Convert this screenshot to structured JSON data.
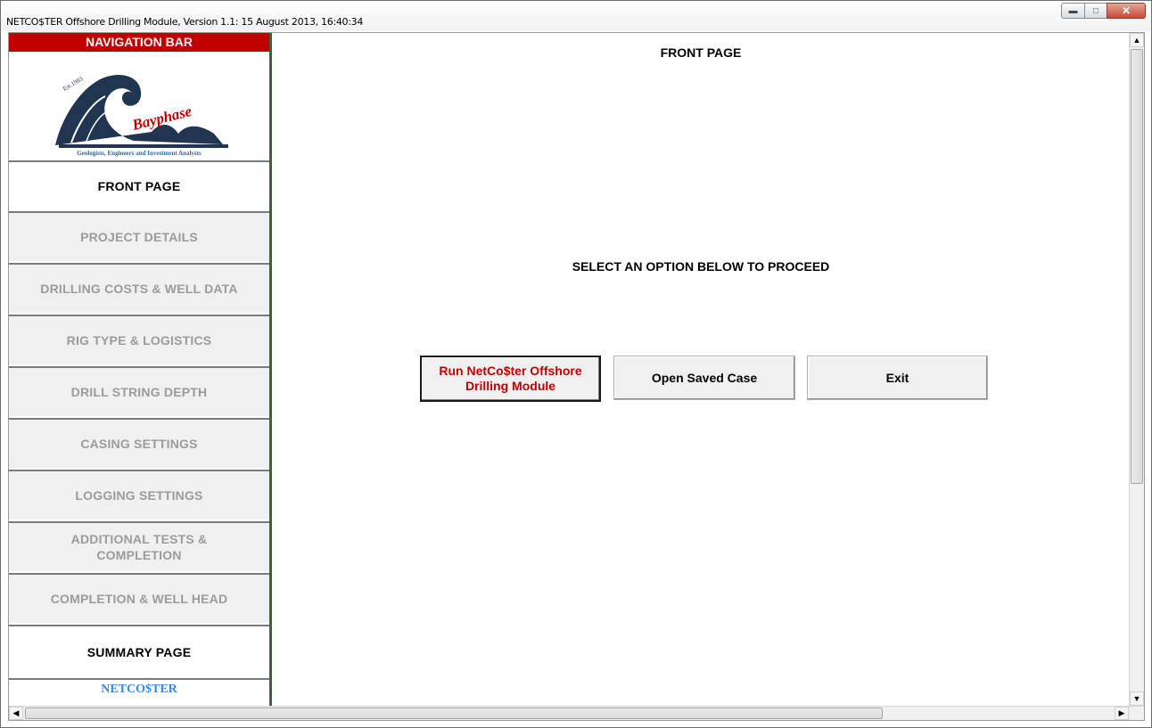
{
  "window": {
    "title": "NETCO$TER Offshore Drilling Module, Version 1.1: 15 August 2013, 16:40:34",
    "controls": {
      "minimize": "minimize-icon",
      "maximize": "maximize-icon",
      "close": "close-icon"
    }
  },
  "nav": {
    "header": "NAVIGATION BAR",
    "logo": {
      "brand": "Bayphase",
      "established": "Est.1983",
      "tagline": "Geologists, Engineers and Investment Analysts"
    },
    "items": [
      {
        "label": "FRONT PAGE",
        "state": "active"
      },
      {
        "label": "PROJECT DETAILS",
        "state": "disabled"
      },
      {
        "label": "DRILLING COSTS & WELL DATA",
        "state": "disabled"
      },
      {
        "label": "RIG TYPE & LOGISTICS",
        "state": "disabled"
      },
      {
        "label": "DRILL STRING DEPTH",
        "state": "disabled"
      },
      {
        "label": "CASING SETTINGS",
        "state": "disabled"
      },
      {
        "label": "LOGGING SETTINGS",
        "state": "disabled"
      },
      {
        "label": "ADDITIONAL TESTS & COMPLETION",
        "state": "disabled"
      },
      {
        "label": "COMPLETION & WELL HEAD",
        "state": "disabled"
      },
      {
        "label": "SUMMARY PAGE",
        "state": "active"
      }
    ],
    "footer": "NETCO$TER"
  },
  "main": {
    "page_title": "FRONT PAGE",
    "instruction": "SELECT AN OPTION BELOW TO PROCEED",
    "buttons": {
      "run": "Run NetCo$ter Offshore Drilling Module",
      "open": "Open Saved Case",
      "exit": "Exit"
    }
  },
  "colors": {
    "nav_header_bg": "#c00000",
    "run_button_text": "#c00000",
    "footer_text": "#3a8ae0",
    "nav_border": "#3f5f3f"
  }
}
